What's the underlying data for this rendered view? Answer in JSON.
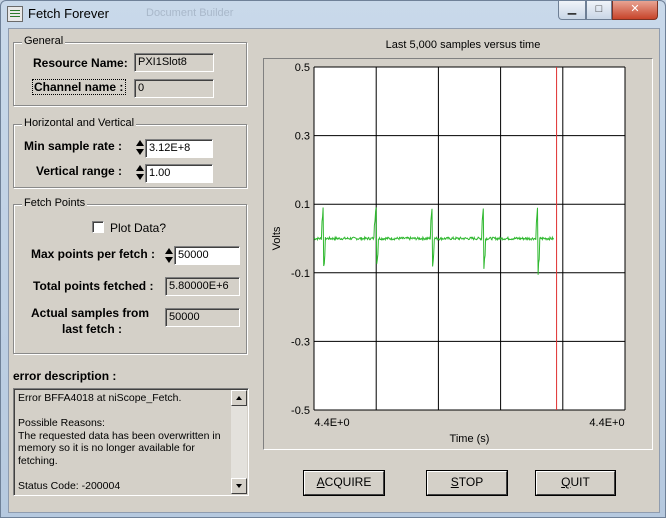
{
  "window": {
    "title": "Fetch Forever",
    "ghost_title": "Document Builder"
  },
  "general": {
    "title": "General",
    "resource_label": "Resource Name:",
    "resource_value": "PXI1Slot8",
    "channel_label": "Channel name :",
    "channel_value": "0"
  },
  "horizontal_vertical": {
    "title": "Horizontal and Vertical",
    "sample_rate_label": "Min sample rate :",
    "sample_rate_value": "3.12E+8",
    "vertical_range_label": "Vertical range :",
    "vertical_range_value": "1.00"
  },
  "fetch_points": {
    "title": "Fetch Points",
    "plot_data_label": "Plot Data?",
    "plot_data_checked": false,
    "max_points_label": "Max points per fetch :",
    "max_points_value": "50000",
    "total_fetched_label": "Total points fetched :",
    "total_fetched_value": "5.80000E+6",
    "actual_samples_label_1": "Actual samples from",
    "actual_samples_label_2": "last fetch :",
    "actual_samples_value": "50000"
  },
  "error": {
    "title": "error description :",
    "text": "Error BFFA4018 at niScope_Fetch.\n\nPossible Reasons:\nThe requested data has been overwritten in memory so it is no longer available for fetching.\n\nStatus Code: -200004"
  },
  "chart_data": {
    "type": "line",
    "title": "Last 5,000 samples versus time",
    "xlabel": "Time (s)",
    "ylabel": "Volts",
    "ylim": [
      -0.5,
      0.5
    ],
    "yticks": [
      "0.5",
      "0.3",
      "0.1",
      "-0.1",
      "-0.3",
      "-0.5"
    ],
    "xtick_labels": [
      "4.4E+0",
      "4.4E+0"
    ],
    "baseline": 0.0,
    "spike_fractions": [
      0.03,
      0.2,
      0.38,
      0.545,
      0.72
    ],
    "spike_amplitude": 0.1,
    "cursor_fraction": 0.78,
    "colors": {
      "trace": "#2fb82f",
      "cursor": "#e03030",
      "plot_bg": "#ffffff",
      "grid": "#000000"
    }
  },
  "buttons": {
    "acquire": "ACQUIRE",
    "stop": "STOP",
    "quit": "QUIT"
  }
}
